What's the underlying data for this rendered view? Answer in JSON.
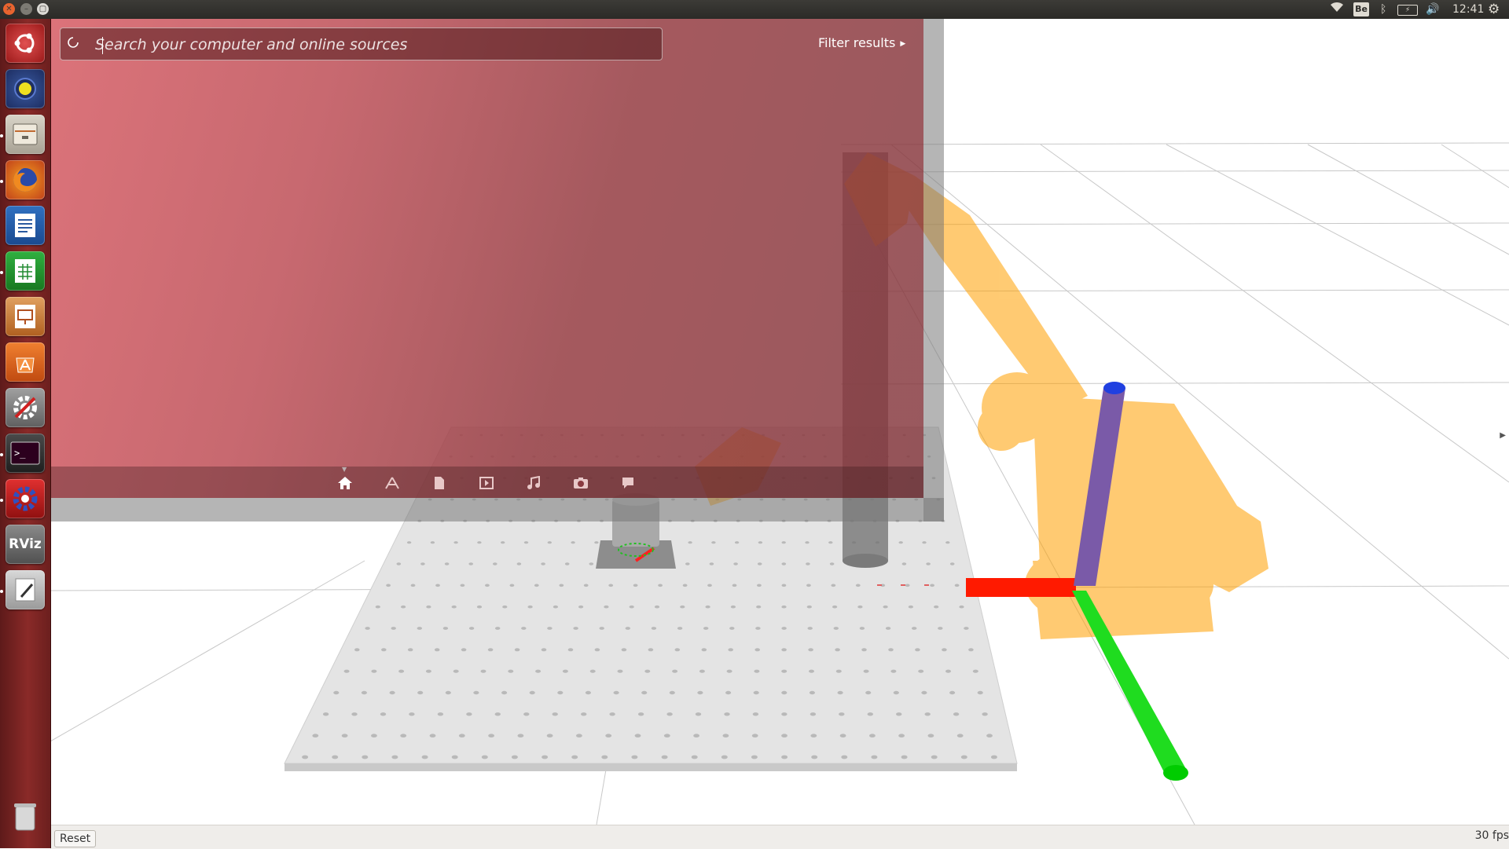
{
  "top_panel": {
    "close_icon": "close-icon",
    "minimize_icon": "minimize-icon",
    "maximize_icon": "maximize-icon",
    "keyboard_indicator": "Be",
    "clock": "12:41"
  },
  "launcher": {
    "items": [
      {
        "name": "dash-home",
        "icon": "ubuntu-logo-icon"
      },
      {
        "name": "gazebo",
        "icon": "gazebo-icon"
      },
      {
        "name": "files",
        "icon": "file-cabinet-icon"
      },
      {
        "name": "firefox",
        "icon": "firefox-icon"
      },
      {
        "name": "libreoffice-writer",
        "icon": "writer-icon"
      },
      {
        "name": "libreoffice-calc",
        "icon": "calc-icon"
      },
      {
        "name": "libreoffice-impress",
        "icon": "impress-icon"
      },
      {
        "name": "ubuntu-software-center",
        "icon": "software-center-icon"
      },
      {
        "name": "system-settings",
        "icon": "settings-icon"
      },
      {
        "name": "terminal",
        "icon": "terminal-icon"
      },
      {
        "name": "ros-settings",
        "icon": "gear-icon"
      },
      {
        "name": "rviz",
        "icon": "rviz-icon",
        "label": "RViz"
      },
      {
        "name": "text-editor",
        "icon": "text-editor-icon"
      },
      {
        "name": "trash",
        "icon": "trash-icon"
      }
    ]
  },
  "dash": {
    "search_placeholder": "Search your computer and online sources",
    "filter_results": "Filter results",
    "lenses": [
      "home-lens-icon",
      "applications-lens-icon",
      "files-lens-icon",
      "video-lens-icon",
      "music-lens-icon",
      "photos-lens-icon",
      "social-lens-icon"
    ]
  },
  "viewport": {
    "reset_label": "Reset",
    "fps": "30 fps"
  },
  "colors": {
    "launcher_bg": "#8a2a28",
    "dash_tint": "#c8505a",
    "robot_orange": "#ffa000",
    "axis_x": "#ff0000",
    "axis_y": "#00e000",
    "axis_z": "#7050a0"
  }
}
